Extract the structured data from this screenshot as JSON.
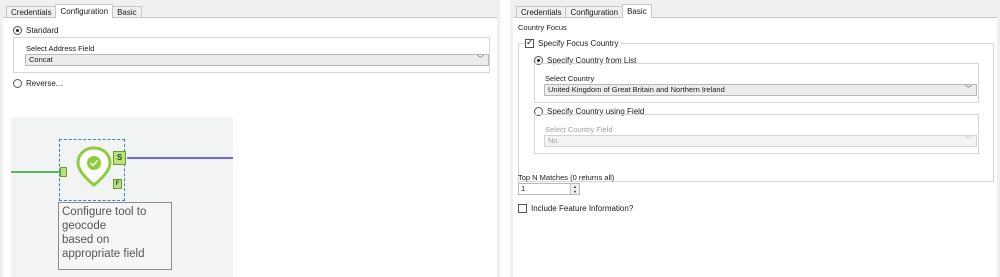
{
  "tabs": [
    "Credentials",
    "Configuration",
    "Basic"
  ],
  "left": {
    "standard_label": "Standard",
    "address_field_label": "Select Address Field",
    "address_field_value": "Concat",
    "reverse_label": "Reverse...",
    "canvas": {
      "output_anchor_s": "S",
      "output_anchor_f": "F",
      "annotation": "Configure tool to\ngeocode\nbased on\nappropriate field"
    }
  },
  "right": {
    "country_focus_label": "Country Focus",
    "specify_focus_country_label": "Specify Focus Country",
    "from_list_label": "Specify Country from List",
    "select_country_label": "Select Country",
    "select_country_value": "United Kingdom of Great Britain and Northern Ireland",
    "using_field_label": "Specify Country using Field",
    "select_country_field_label": "Select Country Field",
    "select_country_field_value": "No.",
    "top_n_label": "Top N Matches (0 returns all)",
    "top_n_value": "1",
    "include_feature_label": "Include Feature Information?"
  },
  "colors": {
    "connection_in": "#5cb85c",
    "connection_out": "#6a6af0",
    "tool_green": "#8ccd3c",
    "selection_blue": "#3b7fd0"
  },
  "icons": [
    "radio-checked",
    "radio-unchecked",
    "checkbox-checked",
    "checkbox-unchecked",
    "chevron-down-icon",
    "map-pin-icon",
    "spin-up-icon",
    "spin-down-icon"
  ]
}
